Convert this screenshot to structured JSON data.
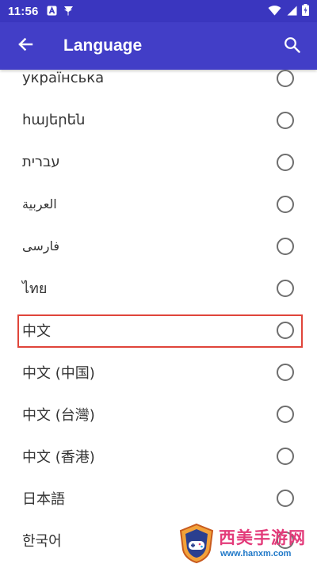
{
  "status_bar": {
    "time": "11:56",
    "left_icons": [
      "notification-a-icon",
      "pin-icon"
    ],
    "right_icons": [
      "wifi-icon",
      "signal-icon",
      "battery-charging-icon"
    ]
  },
  "app_bar": {
    "title": "Language",
    "back_icon": "arrow-back-icon",
    "search_icon": "search-icon",
    "color": "#423ec7"
  },
  "languages": [
    {
      "label": "українська",
      "selected": false
    },
    {
      "label": "հայերեն",
      "selected": false
    },
    {
      "label": "עברית",
      "selected": false
    },
    {
      "label": "العربية",
      "selected": false
    },
    {
      "label": "فارسی",
      "selected": false
    },
    {
      "label": "ไทย",
      "selected": false
    },
    {
      "label": "中文",
      "selected": false,
      "highlighted": true
    },
    {
      "label": "中文 (中国)",
      "selected": false
    },
    {
      "label": "中文 (台灣)",
      "selected": false
    },
    {
      "label": "中文 (香港)",
      "selected": false
    },
    {
      "label": "日本語",
      "selected": false
    },
    {
      "label": "한국어",
      "selected": false
    }
  ],
  "highlight_color": "#e0453a",
  "watermark": {
    "title": "西美手游网",
    "url": "www.hanxm.com"
  }
}
